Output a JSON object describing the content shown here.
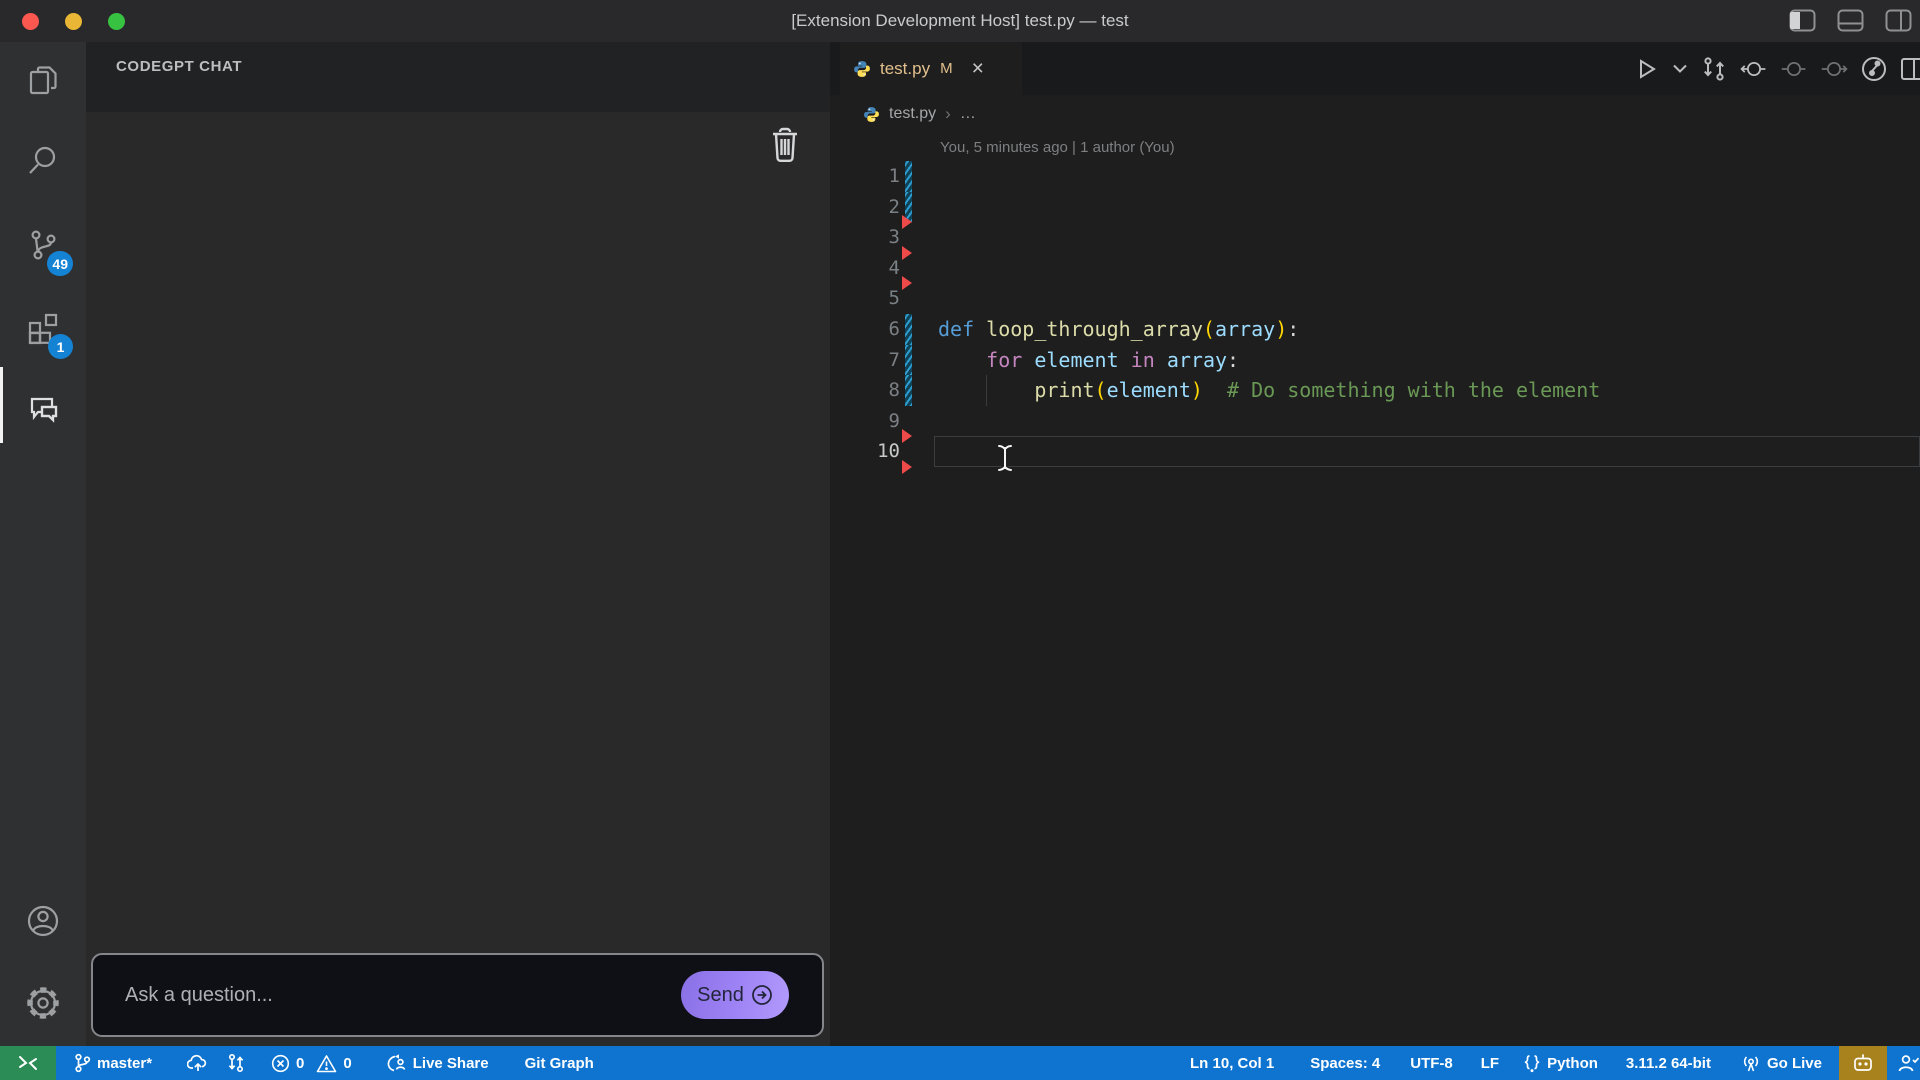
{
  "window": {
    "title": "[Extension Development Host] test.py — test",
    "traffic_light_colors": [
      "#fd5850",
      "#e4bココ",
      "#34c748"
    ],
    "traffic_lights": [
      "#fd5850",
      "#e9b636",
      "#38c242"
    ],
    "layout_icons": [
      "toggle-left-sidebar-icon",
      "toggle-panel-icon",
      "toggle-right-sidebar-icon"
    ]
  },
  "activity_bar": {
    "items": [
      {
        "name": "explorer",
        "active": false
      },
      {
        "name": "search",
        "active": false
      },
      {
        "name": "source-control",
        "badge": "49",
        "active": false
      },
      {
        "name": "extensions",
        "badge": "1",
        "active": false
      },
      {
        "name": "codegpt-chat",
        "active": true
      }
    ],
    "bottom_items": [
      {
        "name": "account"
      },
      {
        "name": "settings"
      }
    ],
    "badge_color": "#1583d3"
  },
  "sidebar": {
    "title": "CODEGPT CHAT",
    "toolbar": {
      "clear_icon": "trash-icon"
    },
    "input": {
      "placeholder": "Ask a question...",
      "send_label": "Send"
    }
  },
  "editor": {
    "tab": {
      "file": "test.py",
      "modified_badge": "M",
      "close_icon": "×"
    },
    "actions": [
      "run-icon",
      "run-dropdown-icon",
      "compare-changes-icon",
      "open-changes-prev-icon",
      "open-changes-icon",
      "open-changes-next-icon",
      "file-history-icon",
      "split-editor-icon"
    ],
    "breadcrumb": {
      "file": "test.py",
      "separator": "›",
      "more": "…"
    },
    "blame": "You, 5 minutes ago | 1 author (You)",
    "code": {
      "lines": [
        {
          "n": 1,
          "tokens": []
        },
        {
          "n": 2,
          "tokens": []
        },
        {
          "n": 3,
          "tokens": []
        },
        {
          "n": 4,
          "tokens": []
        },
        {
          "n": 5,
          "tokens": []
        },
        {
          "n": 6,
          "tokens": [
            [
              "def",
              "kw"
            ],
            [
              " ",
              "d"
            ],
            [
              "loop_through_array",
              "fn"
            ],
            [
              "(",
              "b1"
            ],
            [
              "array",
              "va"
            ],
            [
              ")",
              "b1"
            ],
            [
              ":",
              "d"
            ]
          ]
        },
        {
          "n": 7,
          "tokens": [
            [
              "    ",
              "d"
            ],
            [
              "for",
              "ct"
            ],
            [
              " ",
              "d"
            ],
            [
              "element",
              "va"
            ],
            [
              " ",
              "d"
            ],
            [
              "in",
              "ct"
            ],
            [
              " ",
              "d"
            ],
            [
              "array",
              "va"
            ],
            [
              ":",
              "d"
            ]
          ]
        },
        {
          "n": 8,
          "tokens": [
            [
              "        ",
              "d"
            ],
            [
              "print",
              "fn"
            ],
            [
              "(",
              "b1"
            ],
            [
              "element",
              "va"
            ],
            [
              ")",
              "b1"
            ],
            [
              "  ",
              "d"
            ],
            [
              "# Do something with the element",
              "co"
            ]
          ],
          "guides": [
            4
          ]
        },
        {
          "n": 9,
          "tokens": []
        },
        {
          "n": 10,
          "tokens": [],
          "current": true
        }
      ],
      "modified_lines": [
        1,
        2,
        6,
        7,
        8
      ],
      "deleted_after_lines": [
        2,
        3,
        4,
        9,
        10
      ],
      "active_line": 10,
      "token_colors": {
        "keyword": "#569cd6",
        "function": "#dcdcaa",
        "bracket": "#ffd700",
        "variable": "#9cdcfe",
        "control": "#c586c0",
        "comment": "#6a9955",
        "default": "#d4d4d4"
      }
    }
  },
  "status_bar": {
    "background": "#0e74cf",
    "remote_background": "#2c8c56",
    "remote_icon": "><",
    "branch": "master*",
    "errors": "0",
    "warnings": "0",
    "live_share": "Live Share",
    "git_graph": "Git Graph",
    "cursor_position": "Ln 10, Col 1",
    "indentation": "Spaces: 4",
    "encoding": "UTF-8",
    "eol": "LF",
    "language": "Python",
    "interpreter": "3.11.2 64-bit",
    "go_live": "Go Live",
    "codegpt_background": "#a8821c"
  }
}
